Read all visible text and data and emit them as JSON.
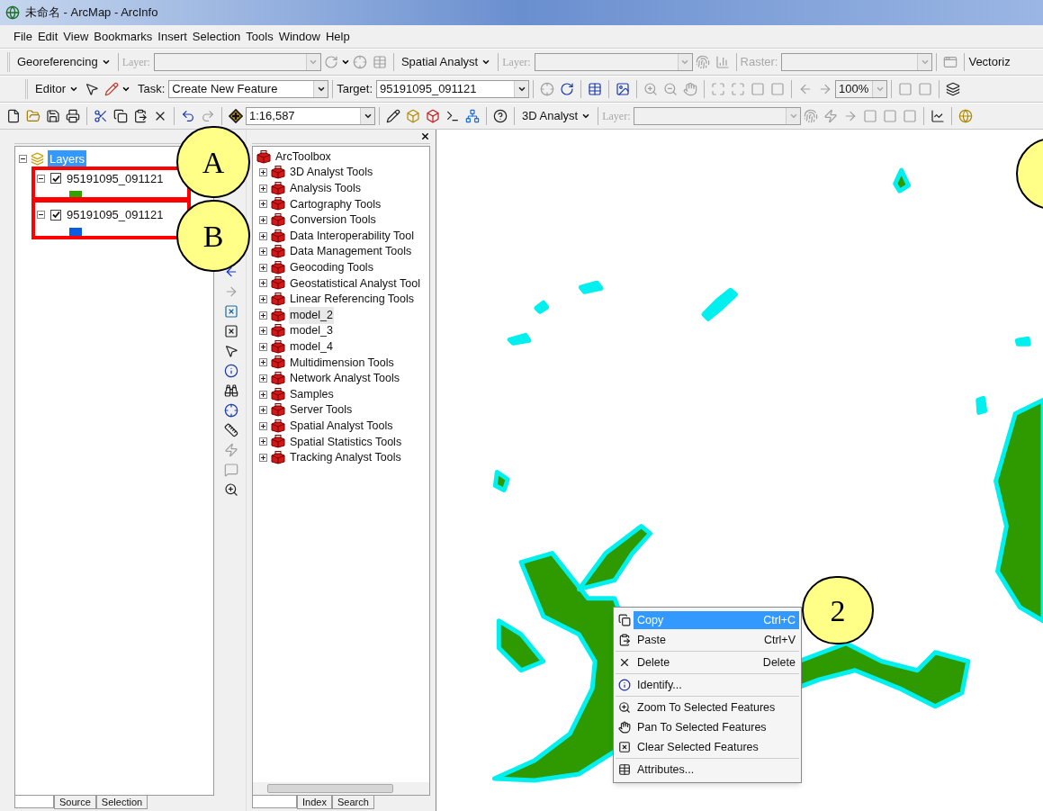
{
  "window": {
    "title": "未命名 - ArcMap - ArcInfo"
  },
  "menu": [
    "File",
    "Edit",
    "View",
    "Bookmarks",
    "Insert",
    "Selection",
    "Tools",
    "Window",
    "Help"
  ],
  "georeferencing_toolbar": {
    "menu": "Georeferencing",
    "layer": {
      "label": "Layer:",
      "disabled": true
    }
  },
  "spatial_analyst_toolbar": {
    "menu": "Spatial Analyst",
    "layer": {
      "label": "Layer:",
      "disabled": true
    }
  },
  "raster_toolbar": {
    "raster": {
      "label": "Raster:",
      "disabled": true
    }
  },
  "vectorization_toolbar": {
    "menu": "Vectoriz"
  },
  "editor_toolbar": {
    "menu": "Editor",
    "task": {
      "label": "Task:",
      "value": "Create New Feature"
    },
    "target": {
      "label": "Target:",
      "value": "95191095_091121"
    }
  },
  "layout_toolbar": {
    "zoom": {
      "value": "100%",
      "disabled": true
    }
  },
  "standard_toolbar": {
    "scale": "1:16,587"
  },
  "analyst_3d_toolbar": {
    "menu": "3D Analyst",
    "layer": {
      "label": "Layer:",
      "disabled": true
    }
  },
  "table_of_contents": {
    "root": {
      "label": "Layers",
      "selected": true,
      "expanded": true
    },
    "layers": [
      {
        "label": "95191095_091121",
        "checked": true,
        "expanded": true,
        "color": "#33a100"
      },
      {
        "label": "95191095_091121",
        "checked": true,
        "expanded": true,
        "color": "#0a5de0"
      }
    ],
    "tabs": [
      "Source",
      "Selection"
    ]
  },
  "toolbox": {
    "title": "ArcToolbox",
    "items": [
      {
        "label": "3D Analyst Tools",
        "expanded": false,
        "selected": false
      },
      {
        "label": "Analysis Tools",
        "expanded": false,
        "selected": false
      },
      {
        "label": "Cartography Tools",
        "expanded": false,
        "selected": false
      },
      {
        "label": "Conversion Tools",
        "expanded": false,
        "selected": false
      },
      {
        "label": "Data Interoperability Tool",
        "expanded": false,
        "selected": false
      },
      {
        "label": "Data Management Tools",
        "expanded": false,
        "selected": false
      },
      {
        "label": "Geocoding Tools",
        "expanded": false,
        "selected": false
      },
      {
        "label": "Geostatistical Analyst Tool",
        "expanded": false,
        "selected": false
      },
      {
        "label": "Linear Referencing Tools",
        "expanded": false,
        "selected": false
      },
      {
        "label": "model_2",
        "expanded": false,
        "selected": true
      },
      {
        "label": "model_3",
        "expanded": false,
        "selected": false
      },
      {
        "label": "model_4",
        "expanded": false,
        "selected": false
      },
      {
        "label": "Multidimension Tools",
        "expanded": false,
        "selected": false
      },
      {
        "label": "Network Analyst Tools",
        "expanded": false,
        "selected": false
      },
      {
        "label": "Samples",
        "expanded": false,
        "selected": false
      },
      {
        "label": "Server Tools",
        "expanded": false,
        "selected": false
      },
      {
        "label": "Spatial Analyst Tools",
        "expanded": false,
        "selected": false
      },
      {
        "label": "Spatial Statistics Tools",
        "expanded": false,
        "selected": false
      },
      {
        "label": "Tracking Analyst Tools",
        "expanded": false,
        "selected": false
      }
    ],
    "tabs": [
      "Index",
      "Search"
    ]
  },
  "context_menu": {
    "groups": [
      [
        {
          "label": "Copy",
          "shortcut": "Ctrl+C",
          "selected": true
        },
        {
          "label": "Paste",
          "shortcut": "Ctrl+V",
          "selected": false
        }
      ],
      [
        {
          "label": "Delete",
          "shortcut": "Delete",
          "selected": false
        }
      ],
      [
        {
          "label": "Identify...",
          "selected": false
        }
      ],
      [
        {
          "label": "Zoom To Selected Features",
          "selected": false
        },
        {
          "label": "Pan To Selected Features",
          "selected": false
        },
        {
          "label": "Clear Selected Features",
          "selected": false
        }
      ],
      [
        {
          "label": "Attributes...",
          "selected": false
        }
      ]
    ]
  },
  "callouts": [
    {
      "label": "A"
    },
    {
      "label": "B"
    },
    {
      "label": "2"
    }
  ]
}
